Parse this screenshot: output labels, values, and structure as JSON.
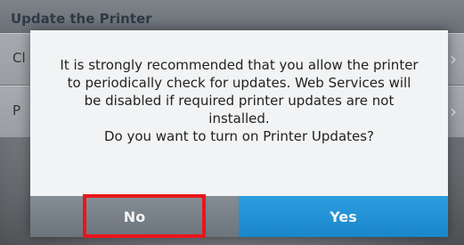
{
  "background": {
    "header_title": "Update the Printer",
    "rows": [
      {
        "label": "Cl",
        "chevron": "›"
      },
      {
        "label": "P",
        "chevron": "›"
      }
    ]
  },
  "dialog": {
    "message_lines": [
      "It is strongly recommended that you allow the printer",
      "to periodically check for updates. Web Services will",
      "be disabled if required printer updates are not",
      "installed.",
      "Do you want to turn on Printer Updates?"
    ],
    "buttons": {
      "no": "No",
      "yes": "Yes"
    }
  },
  "colors": {
    "yes_button": "#1a86cc",
    "no_button": "#6c747c",
    "highlight": "#e8161b"
  }
}
